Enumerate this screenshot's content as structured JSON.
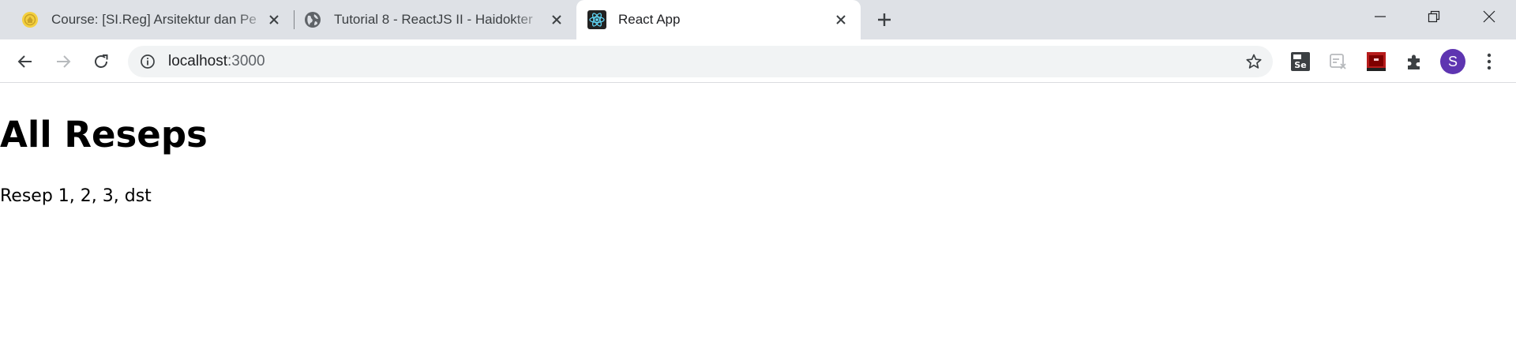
{
  "browser": {
    "tabs": [
      {
        "title": "Course: [SI.Reg] Arsitektur dan Pe",
        "favicon": "moodle-university-icon",
        "active": false
      },
      {
        "title": "Tutorial 8 - ReactJS II - Haidokter",
        "favicon": "globe-icon",
        "active": false
      },
      {
        "title": "React App",
        "favicon": "react-icon",
        "active": true
      }
    ],
    "address": {
      "host": "localhost",
      "port": ":3000"
    },
    "profile_initial": "S",
    "extensions": [
      "selenium-ide-icon",
      "disabled-extension-icon",
      "red-extension-icon",
      "puzzle-extensions-icon"
    ],
    "colors": {
      "tabstrip": "#dee1e6",
      "omnibox": "#f1f3f4",
      "avatar": "#5e35b1"
    }
  },
  "page": {
    "heading": "All Reseps",
    "text": "Resep 1, 2, 3, dst"
  }
}
